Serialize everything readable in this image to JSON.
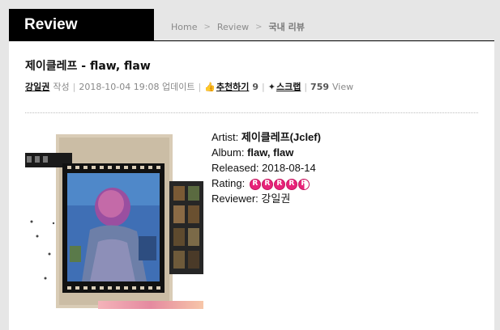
{
  "header": {
    "section_title": "Review",
    "breadcrumb": [
      "Home",
      "Review",
      "국내 리뷰"
    ],
    "separator": ">"
  },
  "article": {
    "title": "제이클레프 - flaw, flaw",
    "author": "강일권",
    "author_suffix": "작성",
    "updated": "2018-10-04 19:08 업데이트",
    "recommend_label": "추천하기",
    "recommend_count": "9",
    "scrap_label": "스크랩",
    "views": "759",
    "views_label": "View"
  },
  "album": {
    "artist_label": "Artist:",
    "artist": "제이클레프(Jclef)",
    "album_label": "Album:",
    "album": "flaw, flaw",
    "released_label": "Released:",
    "released": "2018-08-14",
    "rating_label": "Rating:",
    "rating_value": 4.5,
    "rating_max": 5,
    "rating_glyph": "R",
    "reviewer_label": "Reviewer:",
    "reviewer": "강일권"
  },
  "colors": {
    "tab_bg": "#000000",
    "rating": "#e8237a",
    "page_bg": "#e6e6e6"
  },
  "icons": [
    "thumbs-up-icon",
    "scrap-icon"
  ]
}
